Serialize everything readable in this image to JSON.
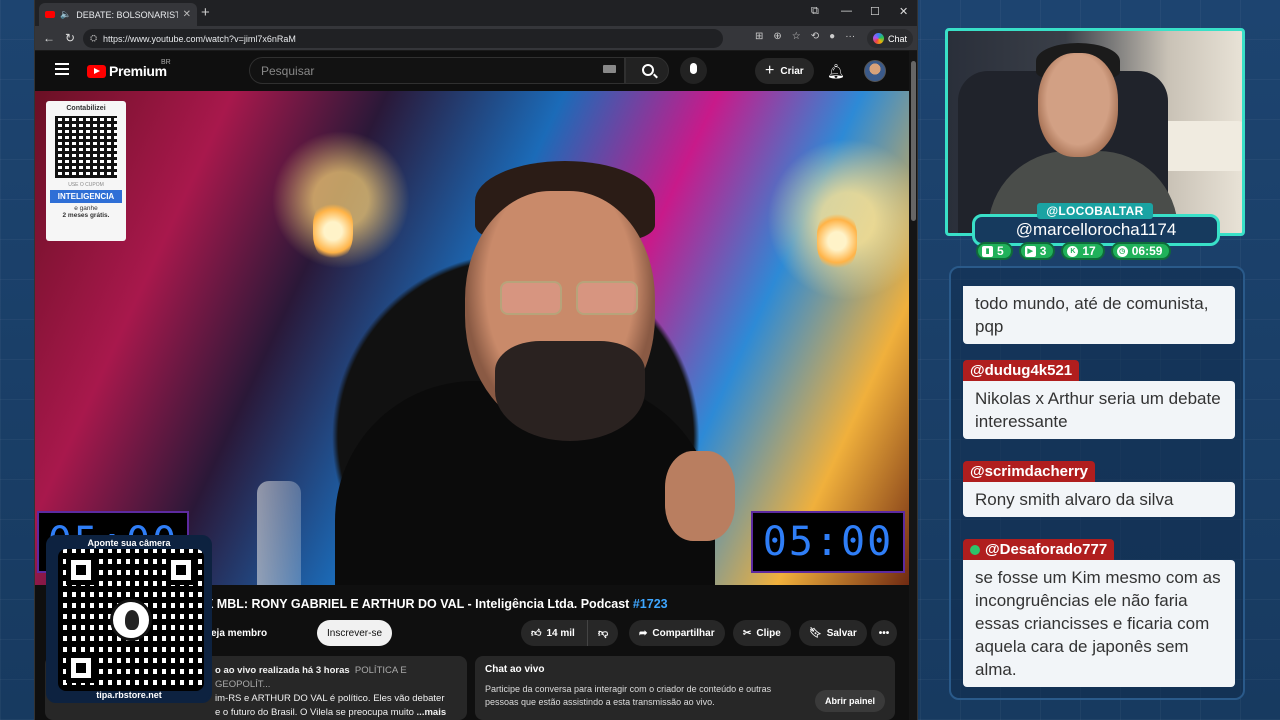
{
  "browser": {
    "tab_title": "DEBATE: BOLSONARISTA X M",
    "url": "https://www.youtube.com/watch?v=jiml7x6nRaM",
    "chat_label": "Chat"
  },
  "masthead": {
    "logo_text": "Premium",
    "region": "BR",
    "search_placeholder": "Pesquisar",
    "create_label": "Criar"
  },
  "video": {
    "sponsor": {
      "brand_top": "Contabilizei",
      "small": "USE O CUPOM",
      "coupon": "INTELIGENCIA",
      "offer_line1": "e ganhe",
      "offer_line2": "2 meses grátis."
    },
    "timer_left": "05:00",
    "timer_right": "05:00",
    "title": "X MBL: RONY GABRIEL E ARTHUR DO VAL - Inteligência Ltda. Podcast",
    "hashtag": "#1723"
  },
  "actions": {
    "member": "eja membro",
    "subscribe": "Inscrever-se",
    "likes": "14 mil",
    "share": "Compartilhar",
    "clip": "Clipe",
    "save": "Salvar"
  },
  "description": {
    "meta": "o ao vivo realizada há 3 horas",
    "category": "POLÍTICA E GEOPOLÍT...",
    "line2": "im-RS e ARTHUR DO VAL é político. Eles vão debater",
    "line3": "e o futuro do Brasil. O Vilela se preocupa muito",
    "more": "...mais"
  },
  "live_chat": {
    "title": "Chat ao vivo",
    "desc": "Participe da conversa para interagir com o criador de conteúdo e outras pessoas que estão assistindo a esta transmissão ao vivo.",
    "open": "Abrir painel"
  },
  "qr_overlay": {
    "top": "Aponte sua câmera",
    "bottom": "tipa.rbstore.net"
  },
  "streamer": {
    "handle_tag": "@LOCOBALTAR",
    "handle_main": "@marcellorocha1174",
    "stats": [
      {
        "icon": "twitch-icon",
        "value": "5"
      },
      {
        "icon": "youtube-icon",
        "value": "3"
      },
      {
        "icon": "kick-icon",
        "value": "17"
      },
      {
        "icon": "clock-icon",
        "value": "06:59"
      }
    ]
  },
  "chat_messages": [
    {
      "user": "",
      "text": "todo mundo, até de comunista, pqp"
    },
    {
      "user": "@dudug4k521",
      "text": "Nikolas x Arthur seria um debate interessante"
    },
    {
      "user": "@scrimdacherry",
      "text": "Rony smith alvaro da silva"
    },
    {
      "user": "@Desaforado777",
      "text": "se fosse um Kim mesmo com as incongruências ele não faria essas criancisses e ficaria com aquela cara de japonês sem alma."
    }
  ],
  "colors": {
    "accent_teal": "#39e0c8",
    "username_red": "#b01e1e",
    "stat_green": "#20b15a",
    "youtube_red": "#ff0000",
    "timer_blue": "#2f7ef7"
  }
}
